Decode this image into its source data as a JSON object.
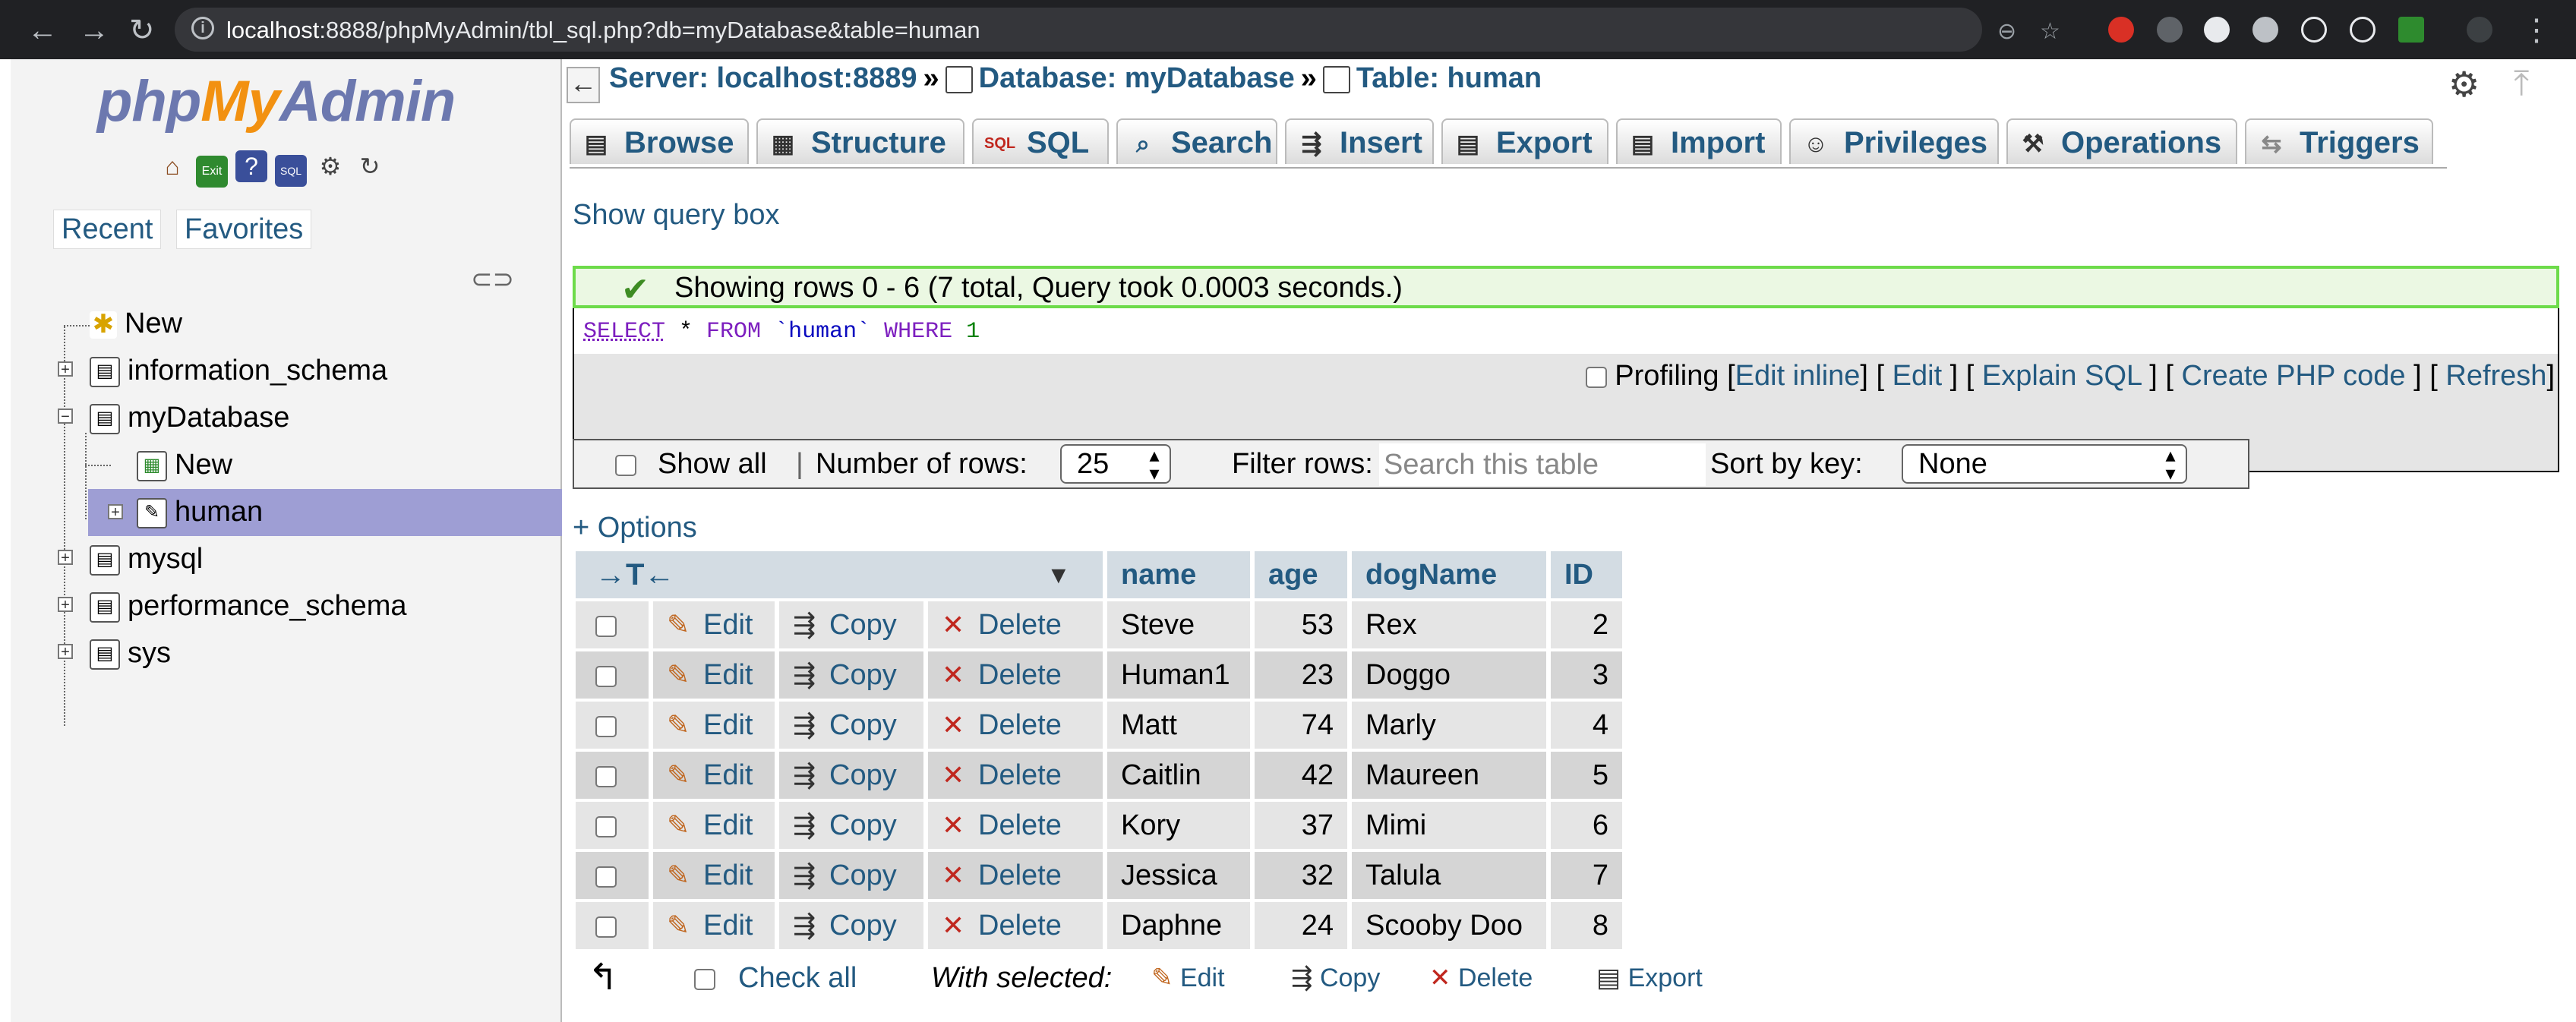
{
  "browser": {
    "url_host": "localhost",
    "url_rest": ":8888/phpMyAdmin/tbl_sql.php?db=myDatabase&table=human"
  },
  "sidebar": {
    "logo": {
      "php": "php",
      "my": "My",
      "admin": "Admin"
    },
    "recent": "Recent",
    "favorites": "Favorites",
    "tree": [
      {
        "label": "New"
      },
      {
        "label": "information_schema"
      },
      {
        "label": "myDatabase"
      },
      {
        "label": "New"
      },
      {
        "label": "human"
      },
      {
        "label": "mysql"
      },
      {
        "label": "performance_schema"
      },
      {
        "label": "sys"
      }
    ]
  },
  "breadcrumb": {
    "server": "Server: localhost:8889",
    "database": "Database: myDatabase",
    "table": "Table: human",
    "sep": "»"
  },
  "tabs": [
    {
      "label": "Browse",
      "icon": "browse-icon"
    },
    {
      "label": "Structure",
      "icon": "structure-icon"
    },
    {
      "label": "SQL",
      "icon": "sql-icon"
    },
    {
      "label": "Search",
      "icon": "search-icon"
    },
    {
      "label": "Insert",
      "icon": "insert-icon"
    },
    {
      "label": "Export",
      "icon": "export-icon"
    },
    {
      "label": "Import",
      "icon": "import-icon"
    },
    {
      "label": "Privileges",
      "icon": "privileges-icon"
    },
    {
      "label": "Operations",
      "icon": "operations-icon"
    },
    {
      "label": "Triggers",
      "icon": "triggers-icon"
    }
  ],
  "show_query_box": "Show query box",
  "message": "Showing rows 0 - 6 (7 total, Query took 0.0003 seconds.)",
  "sql": {
    "select": "SELECT",
    "rest1": " * ",
    "from": "FROM",
    "table": " `human` ",
    "where": "WHERE",
    "num": " 1"
  },
  "sql_actions": {
    "profiling": "Profiling",
    "edit_inline": "Edit inline",
    "edit": "Edit",
    "explain": "Explain SQL",
    "create_php": "Create PHP code",
    "refresh": "Refresh"
  },
  "navbar": {
    "show_all": "Show all",
    "divider": "|",
    "number_of_rows": "Number of rows:",
    "rows_value": "25",
    "filter_rows": "Filter rows:",
    "search_placeholder": "Search this table",
    "sort_by_key": "Sort by key:",
    "sort_value": "None"
  },
  "options_link": "+ Options",
  "table": {
    "columns": [
      "name",
      "age",
      "dogName",
      "ID"
    ],
    "action_labels": {
      "edit": "Edit",
      "copy": "Copy",
      "delete": "Delete"
    },
    "rows": [
      {
        "name": "Steve",
        "age": "53",
        "dogName": "Rex",
        "ID": "2"
      },
      {
        "name": "Human1",
        "age": "23",
        "dogName": "Doggo",
        "ID": "3"
      },
      {
        "name": "Matt",
        "age": "74",
        "dogName": "Marly",
        "ID": "4"
      },
      {
        "name": "Caitlin",
        "age": "42",
        "dogName": "Maureen",
        "ID": "5"
      },
      {
        "name": "Kory",
        "age": "37",
        "dogName": "Mimi",
        "ID": "6"
      },
      {
        "name": "Jessica",
        "age": "32",
        "dogName": "Talula",
        "ID": "7"
      },
      {
        "name": "Daphne",
        "age": "24",
        "dogName": "Scooby Doo",
        "ID": "8"
      }
    ]
  },
  "bottom": {
    "check_all": "Check all",
    "with_selected": "With selected:",
    "edit": "Edit",
    "copy": "Copy",
    "delete": "Delete",
    "export": "Export"
  },
  "colors": {
    "link": "#235a81",
    "success_border": "#6ddb4a",
    "selected_row": "#9e9ed4"
  }
}
